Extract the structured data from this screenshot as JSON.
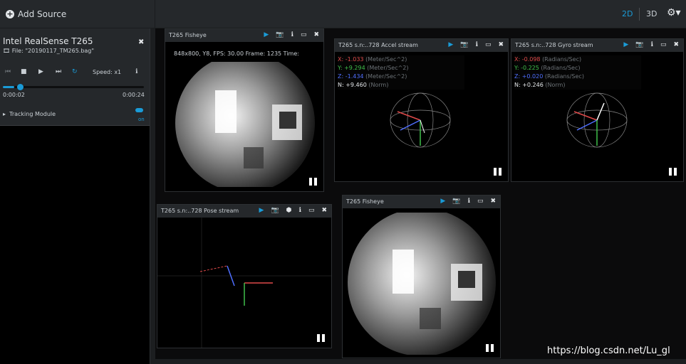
{
  "toolbar": {
    "add_source": "Add Source",
    "view_2d": "2D",
    "view_3d": "3D",
    "settings_icon": "gear-icon"
  },
  "device": {
    "name": "Intel RealSense T265",
    "file": "File: \"20190117_TM265.bag\"",
    "speed_label": "Speed:  x1",
    "time_start": "0:00:02",
    "time_end": "0:00:24",
    "progress_percent": 8,
    "module": "Tracking Module",
    "toggle_label": "on"
  },
  "windows": {
    "fisheye1": {
      "title": "T265 Fisheye",
      "info": "848x800,  Y8,   FPS:  30.00   Frame: 1235       Time:"
    },
    "accel": {
      "title": "T265 s.n:..728 Accel stream",
      "x": "X:  -1.033",
      "y": "Y:  +9.294",
      "z": "Z:  -1.434",
      "n": "N:  +9.460",
      "unit_xyz": "(Meter/Sec^2)",
      "unit_n": "(Norm)"
    },
    "gyro": {
      "title": "T265 s.n:..728 Gyro stream",
      "x": "X:  -0.098",
      "y": "Y:  -0.225",
      "z": "Z:  +0.020",
      "n": "N:  +0.246",
      "unit_xyz": "(Radians/Sec)",
      "unit_n": "(Norm)"
    },
    "pose": {
      "title": "T265 s.n:..728 Pose stream"
    },
    "fisheye2": {
      "title": "T265 Fisheye"
    }
  },
  "colors": {
    "accent": "#1a9bd7",
    "axis_x": "#e04a4a",
    "axis_y": "#3fbf4a",
    "axis_z": "#4f6fff"
  },
  "watermark": "https://blog.csdn.net/Lu_gl"
}
